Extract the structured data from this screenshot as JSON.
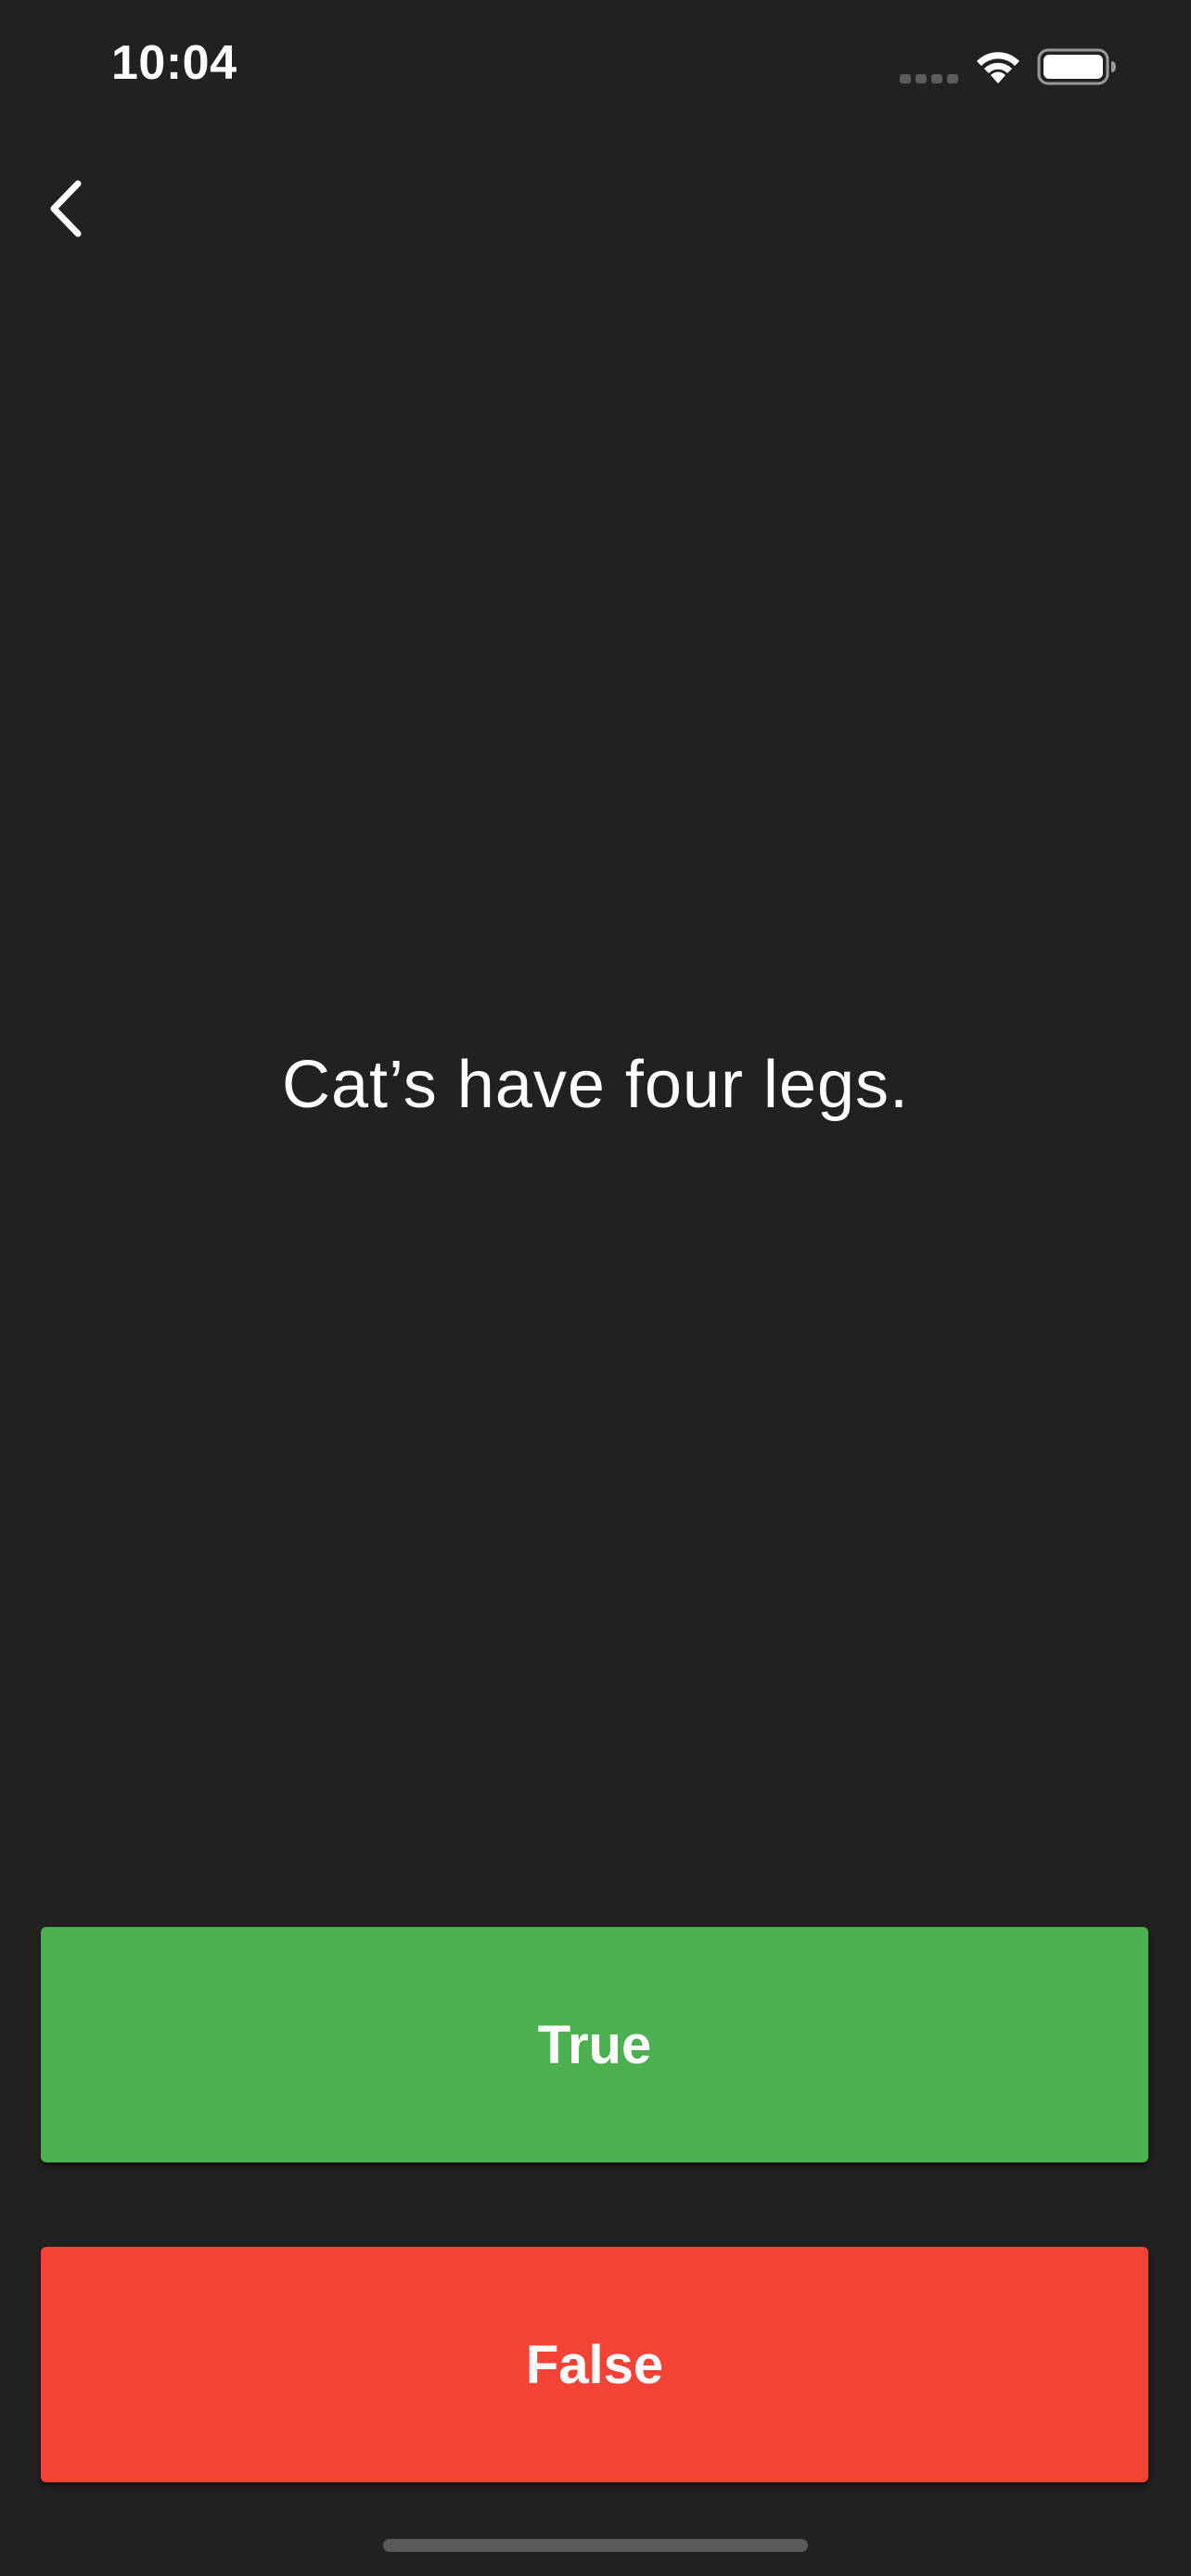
{
  "status_bar": {
    "time": "10:04",
    "signal_icon": "cellular-signal-icon",
    "wifi_icon": "wifi-icon",
    "battery_icon": "battery-full-icon"
  },
  "nav": {
    "back_icon": "chevron-left-icon"
  },
  "quiz": {
    "question": "Cat’s have four legs."
  },
  "answers": {
    "true_label": "True",
    "false_label": "False"
  },
  "colors": {
    "background": "#212121",
    "true_button": "#4caf50",
    "false_button": "#f44336",
    "text": "#ffffff"
  }
}
